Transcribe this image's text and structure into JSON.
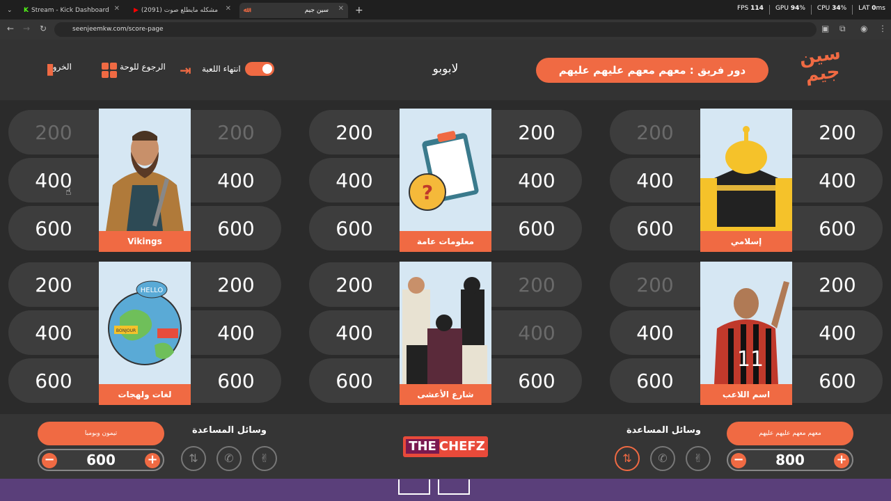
{
  "browser": {
    "tabs": [
      {
        "title": "Stream - Kick Dashboard",
        "active": false
      },
      {
        "title": "(2091) حل مشكله مايطلع صوت",
        "active": false
      },
      {
        "title": "سين جيم",
        "active": true
      }
    ],
    "url": "seenjeemkw.com/score-page",
    "stats": {
      "fps_label": "FPS",
      "fps": "114",
      "gpu_label": "GPU",
      "gpu": "94",
      "cpu_label": "CPU",
      "cpu": "34",
      "lat_label": "LAT",
      "lat": "0"
    }
  },
  "header": {
    "logo_line1": "سين",
    "logo_line2": "جيم",
    "turn_label": "دور فريق : معهم معهم عليهم عليهم",
    "game_name": "لابوبو",
    "end_game": "انتهاء اللعبة",
    "back_board": "الرجوع للوحة",
    "exit": "الخروج"
  },
  "categories": [
    {
      "name": "Vikings",
      "left": [
        "200",
        "400",
        "600"
      ],
      "right": [
        "200",
        "400",
        "600"
      ],
      "left_used": [
        true,
        false,
        false
      ],
      "right_used": [
        true,
        false,
        false
      ]
    },
    {
      "name": "معلومات عامة",
      "left": [
        "200",
        "400",
        "600"
      ],
      "right": [
        "200",
        "400",
        "600"
      ],
      "left_used": [
        false,
        false,
        false
      ],
      "right_used": [
        false,
        false,
        false
      ]
    },
    {
      "name": "إسلامي",
      "left": [
        "200",
        "400",
        "600"
      ],
      "right": [
        "200",
        "400",
        "600"
      ],
      "left_used": [
        true,
        false,
        false
      ],
      "right_used": [
        false,
        false,
        false
      ]
    },
    {
      "name": "لغات ولهجات",
      "left": [
        "200",
        "400",
        "600"
      ],
      "right": [
        "200",
        "400",
        "600"
      ],
      "left_used": [
        false,
        false,
        false
      ],
      "right_used": [
        false,
        false,
        false
      ]
    },
    {
      "name": "شارع الأعشى",
      "left": [
        "200",
        "400",
        "600"
      ],
      "right": [
        "200",
        "400",
        "600"
      ],
      "left_used": [
        false,
        false,
        false
      ],
      "right_used": [
        true,
        true,
        false
      ]
    },
    {
      "name": "اسم اللاعب",
      "left": [
        "200",
        "400",
        "600"
      ],
      "right": [
        "200",
        "400",
        "600"
      ],
      "left_used": [
        true,
        false,
        false
      ],
      "right_used": [
        false,
        false,
        false
      ]
    }
  ],
  "card_art": {
    "vikings_hello": "HELLO",
    "bonjour": "BONJOUR",
    "jersey": "11"
  },
  "footer": {
    "left_team": {
      "name": "تيمون وبومبا",
      "score": "600"
    },
    "right_team": {
      "name": "معهم معهم عليهم عليهم",
      "score": "800"
    },
    "helpers_title": "وسائل المساعدة",
    "sponsor_a": "THE",
    "sponsor_b": "CHEFZ",
    "minus": "−",
    "plus": "+"
  }
}
